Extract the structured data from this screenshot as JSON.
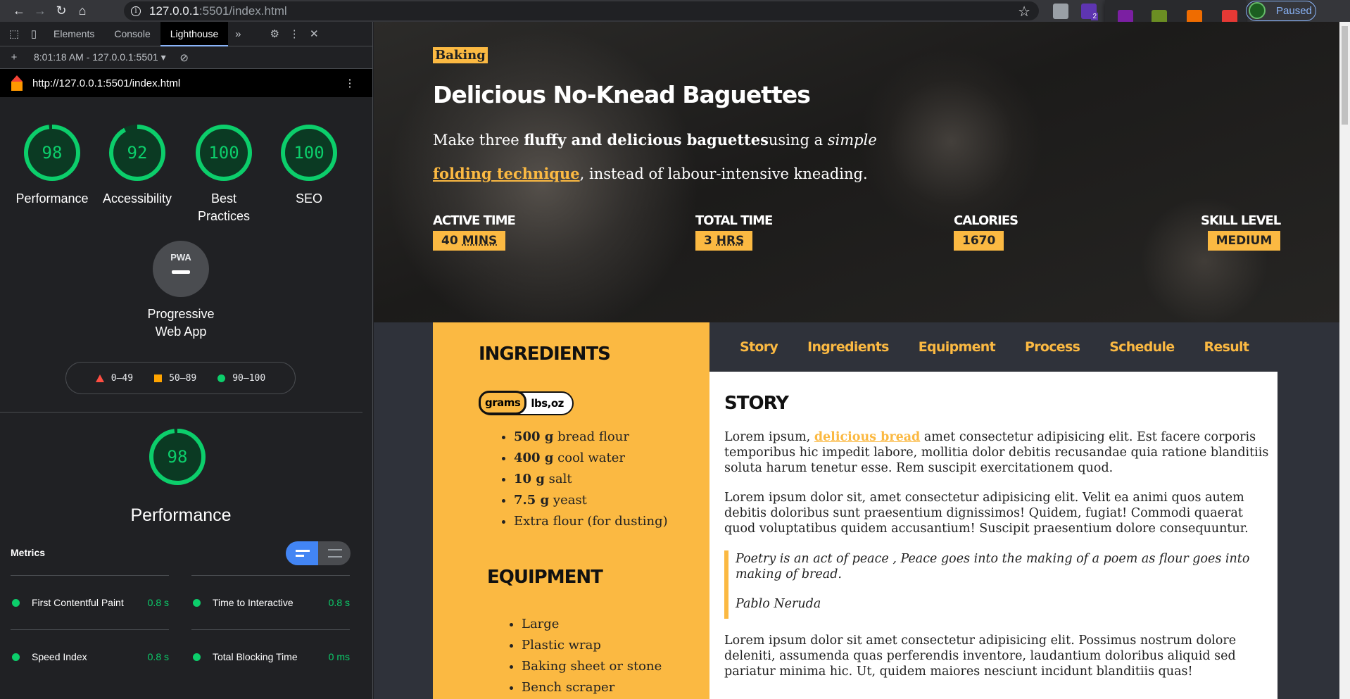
{
  "browser": {
    "url_host": "127.0.0.1",
    "url_rest": ":5501/index.html",
    "profile_status": "Paused",
    "badge_count": "2"
  },
  "devtools": {
    "tabs": [
      "Elements",
      "Console",
      "Lighthouse"
    ],
    "active_tab": "Lighthouse",
    "report_time": "8:01:18 AM - 127.0.0.1:5501",
    "report_url": "http://127.0.0.1:5501/index.html",
    "scores": [
      {
        "label": "Performance",
        "value": "98",
        "fraction": 0.98
      },
      {
        "label": "Accessibility",
        "value": "92",
        "fraction": 0.92
      },
      {
        "label": "Best Practices",
        "value": "100",
        "fraction": 1.0
      },
      {
        "label": "SEO",
        "value": "100",
        "fraction": 1.0
      }
    ],
    "pwa": {
      "abbr": "PWA",
      "label": "Progressive Web App"
    },
    "legend": [
      "0–49",
      "50–89",
      "90–100"
    ],
    "performance": {
      "value": "98",
      "fraction": 0.98,
      "label": "Performance"
    },
    "metrics_title": "Metrics",
    "metrics": [
      {
        "label": "First Contentful Paint",
        "value": "0.8 s"
      },
      {
        "label": "Time to Interactive",
        "value": "0.8 s"
      },
      {
        "label": "Speed Index",
        "value": "0.8 s"
      },
      {
        "label": "Total Blocking Time",
        "value": "0 ms"
      }
    ]
  },
  "recipe": {
    "category": "Baking",
    "title": "Delicious No-Knead Baguettes",
    "lede_1": "Make three ",
    "lede_bold": "fluffy and delicious baguettes",
    "lede_2": "using a ",
    "lede_italic": "simple",
    "lede_link": "folding technique",
    "lede_3": ", instead of labour-intensive kneading.",
    "stats": [
      {
        "label": "ACTIVE TIME",
        "value_num": "40 ",
        "value_unit": "MINS"
      },
      {
        "label": "TOTAL TIME",
        "value_num": "3 ",
        "value_unit": "HRS"
      },
      {
        "label": "CALORIES",
        "value_num": "1670",
        "value_unit": ""
      },
      {
        "label": "SKILL LEVEL",
        "value_num": "MEDIUM",
        "value_unit": ""
      }
    ],
    "ingredients_title": "INGREDIENTS",
    "unit_options": [
      "grams",
      "lbs,oz"
    ],
    "ingredients": [
      {
        "qty": "500 g",
        "name": " bread flour"
      },
      {
        "qty": "400 g",
        "name": " cool water"
      },
      {
        "qty": "10 g",
        "name": " salt"
      },
      {
        "qty": "7.5 g",
        "name": " yeast"
      },
      {
        "qty": "",
        "name": "Extra flour (for dusting)"
      }
    ],
    "equipment_title": "EQUIPMENT",
    "equipment": [
      "Large",
      "Plastic wrap",
      "Baking sheet or stone",
      "Bench scraper"
    ],
    "tabs": [
      "Story",
      "Ingredients",
      "Equipment",
      "Process",
      "Schedule",
      "Result"
    ],
    "story": {
      "title": "STORY",
      "p1_a": "Lorem ipsum, ",
      "p1_link": "delicious bread",
      "p1_b": " amet consectetur adipisicing elit. Est facere corporis temporibus hic impedit labore, mollitia dolor debitis recusandae quia ratione blanditiis soluta harum tenetur esse. Rem suscipit exercitationem quod.",
      "p2": "Lorem ipsum dolor sit, amet consectetur adipisicing elit. Velit ea animi quos autem debitis doloribus sunt praesentium dignissimos! Quidem, fugiat! Commodi quaerat quod voluptatibus quidem accusantium! Suscipit praesentium dolore consequuntur.",
      "quote": "Poetry is an act of peace , Peace goes into the making of a poem as flour goes into making of bread.",
      "quote_author": "Pablo Neruda",
      "p3": "Lorem ipsum dolor sit amet consectetur adipisicing elit. Possimus nostrum dolore deleniti, assumenda quas perferendis inventore, laudantium doloribus aliquid sed pariatur minima hic. Ut, quidem maiores nesciunt incidunt blanditiis quas!"
    }
  },
  "colors": {
    "accent": "#fbb942",
    "pass": "#0cce6b",
    "fail": "#ff4e42",
    "average": "#ffa400"
  }
}
